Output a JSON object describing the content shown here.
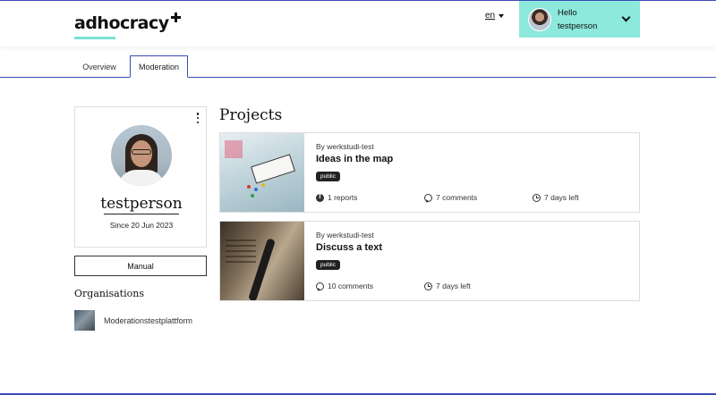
{
  "header": {
    "logo_text": "adhocracy",
    "language": "en",
    "user_greeting": "Hello",
    "user_name": "testperson"
  },
  "tabs": [
    {
      "label": "Overview",
      "active": false
    },
    {
      "label": "Moderation",
      "active": true
    }
  ],
  "profile": {
    "name": "testperson",
    "since": "Since 20 Jun 2023",
    "manual_button": "Manual"
  },
  "organisations": {
    "heading": "Organisations",
    "items": [
      {
        "name": "Moderationstestplattform"
      }
    ]
  },
  "projects": {
    "title": "Projects",
    "items": [
      {
        "by": "By werkstudi-test",
        "title": "Ideas in the map",
        "badge": "public",
        "reports": "1 reports",
        "comments": "7 comments",
        "time_left": "7 days left"
      },
      {
        "by": "By werkstudi-test",
        "title": "Discuss a text",
        "badge": "public",
        "comments": "10 comments",
        "time_left": "7 days left"
      }
    ]
  },
  "colors": {
    "accent": "#8ce9dc",
    "brand_blue": "#3b4ab8"
  }
}
